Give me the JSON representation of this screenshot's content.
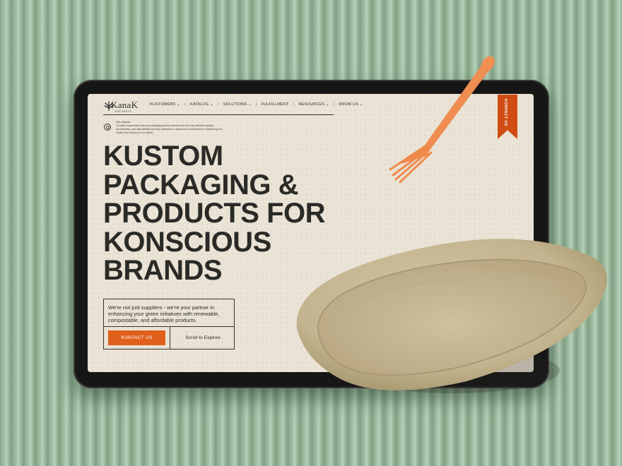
{
  "brand": {
    "logo_text": "KanaK",
    "logo_sub": "NATURALS"
  },
  "nav": {
    "items": [
      {
        "label": "KUSTOMERS",
        "has_dropdown": true
      },
      {
        "label": "KATALOG",
        "has_dropdown": true
      },
      {
        "label": "SOLUTIONS",
        "has_dropdown": true
      },
      {
        "label": "FULFILLMENT",
        "has_dropdown": false
      },
      {
        "label": "RESOURCES",
        "has_dropdown": true
      },
      {
        "label": "KNOW US",
        "has_dropdown": true
      }
    ],
    "separator": "/",
    "dropdown_glyph": "⌄"
  },
  "mission": {
    "title": "Our mission:",
    "text": "To kraft responsibly-sourced packaging and products that not only prioritize quality, functionality, and affordability but also champion a profound commitment to enhancing the health and beauty of our planet."
  },
  "hero": {
    "headline_lines": [
      "KUSTOM",
      "PACKAGING &",
      "PRODUCTS FOR",
      "KONSCIOUS",
      "BRANDS"
    ],
    "subtext": "We're not just suppliers - we're your partner in enhancing your green initiatives with renewable, compostable, and affordable products.",
    "cta_label": "KONTACT US",
    "scroll_label": "Scroll to Explore"
  },
  "side_tab": {
    "label": "KONTACT US"
  },
  "colors": {
    "accent": "#df5f1b",
    "tab": "#cf4c14",
    "screen_bg": "#ebe4d6",
    "text": "#2a2a27",
    "backdrop": "#8fae92"
  },
  "icons": [
    "logo-leaf-icon",
    "mission-globe-icon",
    "chevron-down-icon",
    "fork-illustration",
    "plate-illustration"
  ]
}
